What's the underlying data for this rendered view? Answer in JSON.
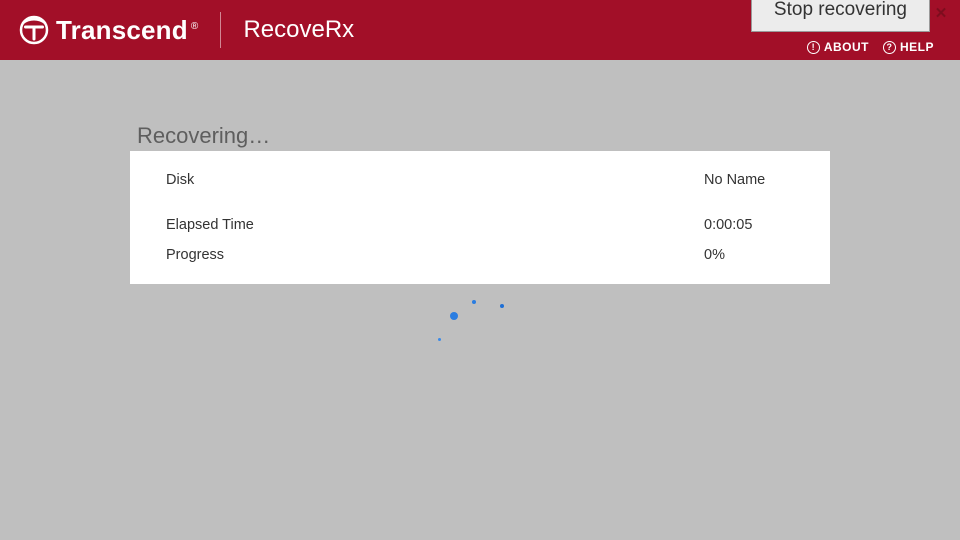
{
  "header": {
    "brand_name": "Transcend",
    "registered_mark": "®",
    "app_name": "RecoveRx",
    "about_label": "ABOUT",
    "help_label": "HELP",
    "about_icon_glyph": "!",
    "help_icon_glyph": "?"
  },
  "window": {
    "minimize_glyph": "—",
    "close_glyph": "✕"
  },
  "status": {
    "title": "Recovering…"
  },
  "info": {
    "rows": [
      {
        "label": "Disk",
        "value": "No Name"
      },
      {
        "label": "Elapsed Time",
        "value": "0:00:05"
      },
      {
        "label": "Progress",
        "value": "0%"
      }
    ]
  },
  "actions": {
    "stop_label": "Stop recovering"
  },
  "colors": {
    "header_bg": "#a20f28",
    "body_bg": "#bfbfbf",
    "spinner": "#2a7de1"
  }
}
